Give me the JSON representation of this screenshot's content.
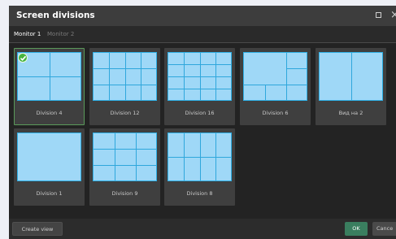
{
  "window": {
    "title": "Screen divisions"
  },
  "tabs": [
    {
      "label": "Monitor 1",
      "active": true
    },
    {
      "label": "Monitor 2",
      "active": false
    }
  ],
  "divisions": [
    {
      "label": "Division 4",
      "selected": true
    },
    {
      "label": "Division 12",
      "selected": false
    },
    {
      "label": "Division 16",
      "selected": false
    },
    {
      "label": "Division 6",
      "selected": false
    },
    {
      "label": "Вид на 2",
      "selected": false
    },
    {
      "label": "Division 1",
      "selected": false
    },
    {
      "label": "Division 9",
      "selected": false
    },
    {
      "label": "Division 8",
      "selected": false
    }
  ],
  "footer": {
    "create_label": "Create view",
    "ok_label": "OK",
    "cancel_label": "Cance"
  },
  "colors": {
    "accent_ok": "#3a7e5f",
    "thumb_fill": "#9fd8f7",
    "thumb_lines": "#2fa7dc",
    "selected_check": "#47b53f"
  }
}
